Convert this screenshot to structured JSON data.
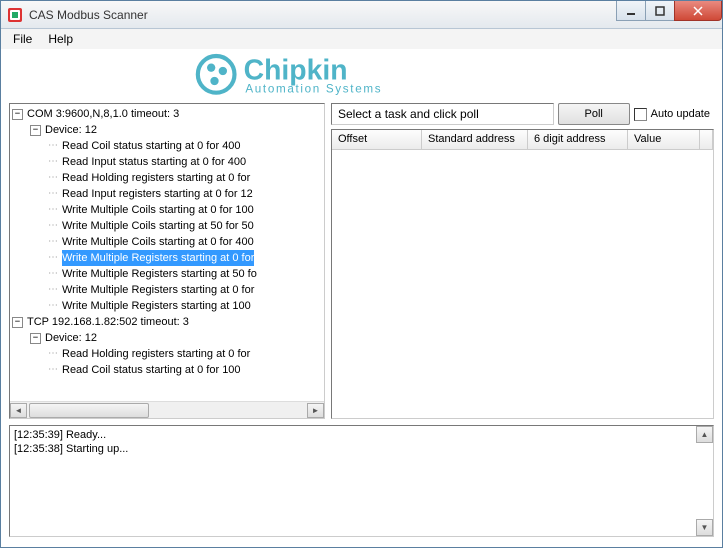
{
  "window": {
    "title": "CAS Modbus Scanner"
  },
  "menu": {
    "file": "File",
    "help": "Help"
  },
  "logo": {
    "brand": "Chipkin",
    "subtitle": "Automation Systems"
  },
  "tree": {
    "conn1": {
      "label": "COM 3:9600,N,8,1.0 timeout: 3",
      "device": {
        "label": "Device: 12"
      },
      "tasks": [
        "Read Coil status starting at 0 for 400",
        "Read Input status starting at 0 for 400",
        "Read Holding registers starting at 0 for",
        "Read Input registers starting at 0 for 12",
        "Write Multiple Coils starting at 0 for 100",
        "Write Multiple Coils starting at 50 for 50",
        "Write Multiple Coils starting at 0 for 400",
        "Write Multiple Registers starting at 0 for",
        "Write Multiple Registers starting at 50 fo",
        "Write Multiple Registers starting at 0 for",
        "Write Multiple Registers starting at 100"
      ],
      "selected_index": 7
    },
    "conn2": {
      "label": "TCP 192.168.1.82:502 timeout: 3",
      "device": {
        "label": "Device: 12"
      },
      "tasks": [
        "Read Holding registers starting at 0 for",
        "Read Coil status starting at 0 for 100"
      ]
    }
  },
  "taskbar": {
    "prompt": "Select a task and click poll",
    "poll_label": "Poll",
    "auto_update_label": "Auto update"
  },
  "grid": {
    "columns": {
      "offset": "Offset",
      "standard": "Standard address",
      "sixdigit": "6 digit address",
      "value": "Value"
    }
  },
  "log": {
    "lines": [
      "[12:35:39] Ready...",
      "[12:35:38] Starting up..."
    ]
  }
}
